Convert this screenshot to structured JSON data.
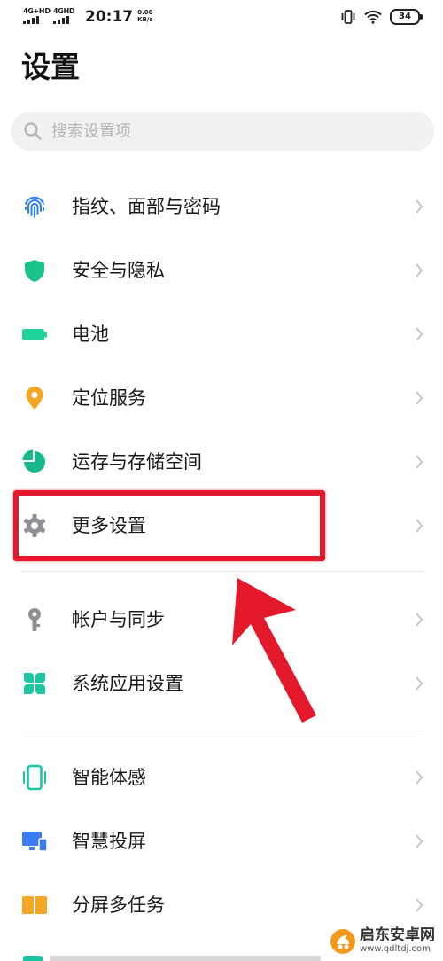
{
  "status_bar": {
    "sim1_label": "4G+HD",
    "sim2_label": "4GHD",
    "time": "20:17",
    "speed_value": "0.00",
    "speed_unit": "KB/s",
    "battery": "34"
  },
  "page_title": "设置",
  "search": {
    "placeholder": "搜索设置项"
  },
  "items": [
    {
      "label": "指纹、面部与密码",
      "icon": "fingerprint-icon",
      "color": "#2d7ff0"
    },
    {
      "label": "安全与隐私",
      "icon": "shield-icon",
      "color": "#18c28a"
    },
    {
      "label": "电池",
      "icon": "battery-icon",
      "color": "#1fd39a"
    },
    {
      "label": "定位服务",
      "icon": "location-pin-icon",
      "color": "#f5a623"
    },
    {
      "label": "运存与存储空间",
      "icon": "pie-chart-icon",
      "color": "#17b889"
    },
    {
      "label": "更多设置",
      "icon": "gear-icon",
      "color": "#8e8e93"
    },
    {
      "label": "帐户与同步",
      "icon": "key-icon",
      "color": "#8e8e93"
    },
    {
      "label": "系统应用设置",
      "icon": "clover-icon",
      "color": "#1bc7a0"
    },
    {
      "label": "智能体感",
      "icon": "phone-icon",
      "color": "#1bc7a0"
    },
    {
      "label": "智慧投屏",
      "icon": "screen-cast-icon",
      "color": "#3b7cf5"
    },
    {
      "label": "分屏多任务",
      "icon": "split-screen-icon",
      "color": "#f5a623"
    }
  ],
  "annotation": {
    "color": "#e4182b"
  },
  "watermark": {
    "name": "启东安卓网",
    "url": "www.qdltdj.com"
  }
}
